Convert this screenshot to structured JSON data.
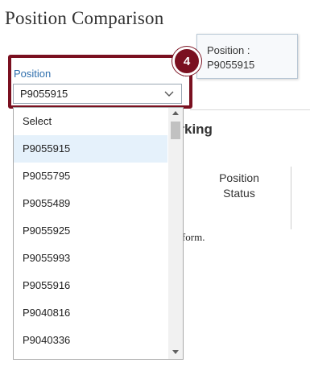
{
  "page": {
    "title": "Position Comparison"
  },
  "background": {
    "heading_fragment": "orking",
    "column_header_line1": "Position",
    "column_header_line2": "Status",
    "note_fragment": "is form."
  },
  "tooltip": {
    "line1": "Position :",
    "line2": "P9055915"
  },
  "callout": {
    "number": "4",
    "color": "#7a1020"
  },
  "position_field": {
    "label": "Position",
    "value": "P9055915",
    "options": [
      "Select",
      "P9055915",
      "P9055795",
      "P9055489",
      "P9055925",
      "P9055993",
      "P9055916",
      "P9040816",
      "P9040336"
    ],
    "highlighted_option": "P9055915"
  },
  "icons": {
    "dropdown": "chevron-down-icon",
    "scroll_up": "scroll-up-arrow-icon",
    "scroll_down": "scroll-down-arrow-icon"
  }
}
